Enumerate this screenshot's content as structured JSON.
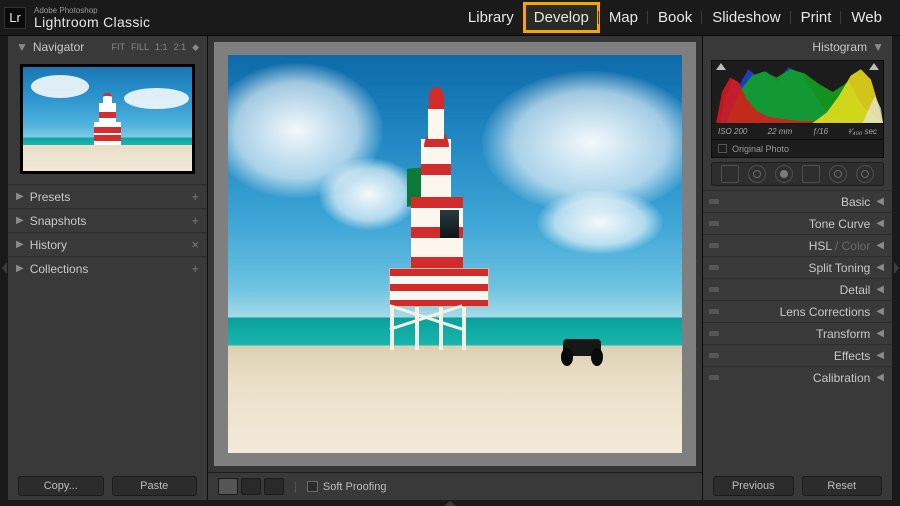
{
  "brand": {
    "small": "Adobe Photoshop",
    "big": "Lightroom Classic",
    "logo": "Lr"
  },
  "modules": [
    {
      "label": "Library",
      "active": false
    },
    {
      "label": "Develop",
      "active": true
    },
    {
      "label": "Map",
      "active": false
    },
    {
      "label": "Book",
      "active": false
    },
    {
      "label": "Slideshow",
      "active": false
    },
    {
      "label": "Print",
      "active": false
    },
    {
      "label": "Web",
      "active": false
    }
  ],
  "navigator": {
    "title": "Navigator",
    "zoom": [
      "FIT",
      "FILL",
      "1:1",
      "2:1"
    ]
  },
  "left_panels": [
    {
      "label": "Presets",
      "action": "+"
    },
    {
      "label": "Snapshots",
      "action": "+"
    },
    {
      "label": "History",
      "action": "×"
    },
    {
      "label": "Collections",
      "action": "+"
    }
  ],
  "left_buttons": {
    "copy": "Copy...",
    "paste": "Paste"
  },
  "center_foot": {
    "soft_proof": "Soft Proofing"
  },
  "histogram": {
    "title": "Histogram",
    "iso": "ISO 200",
    "focal": "22 mm",
    "aperture": "ƒ/16",
    "shutter": "¹⁄₄₀₀ sec",
    "original": "Original Photo"
  },
  "right_panels": [
    {
      "label": "Basic"
    },
    {
      "label": "Tone Curve"
    },
    {
      "label": "HSL",
      "dimpart": " / Color"
    },
    {
      "label": "Split Toning"
    },
    {
      "label": "Detail"
    },
    {
      "label": "Lens Corrections"
    },
    {
      "label": "Transform"
    },
    {
      "label": "Effects"
    },
    {
      "label": "Calibration"
    }
  ],
  "right_buttons": {
    "prev": "Previous",
    "reset": "Reset"
  }
}
